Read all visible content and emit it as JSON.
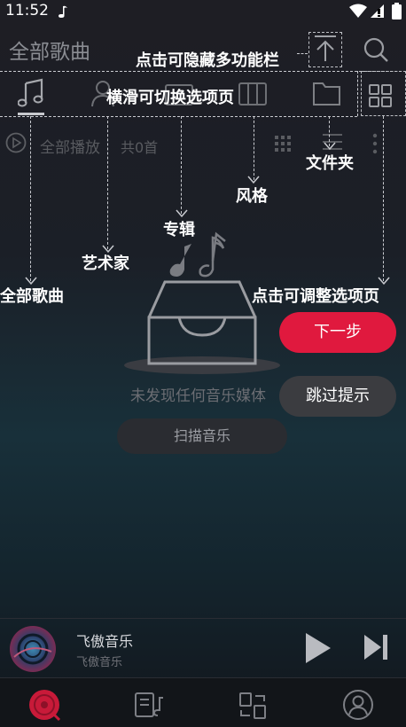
{
  "status": {
    "time": "11:52"
  },
  "header": {
    "title": "全部歌曲"
  },
  "tabs": [
    {
      "name": "songs"
    },
    {
      "name": "artists"
    },
    {
      "name": "albums"
    },
    {
      "name": "genres"
    },
    {
      "name": "folders"
    }
  ],
  "list_header": {
    "play_all": "全部播放",
    "count": "共0首"
  },
  "empty": {
    "message": "未发现任何音乐媒体",
    "scan_button": "扫描音乐"
  },
  "guide": {
    "hide_toolbar": "点击可隐藏多功能栏",
    "swipe_tabs": "横滑可切换选项页",
    "folder": "文件夹",
    "genre": "风格",
    "album": "专辑",
    "artist": "艺术家",
    "all_songs": "全部歌曲",
    "adjust_tabs": "点击可调整选项页",
    "next_button": "下一步",
    "skip_button": "跳过提示"
  },
  "player": {
    "title": "飞傲音乐",
    "subtitle": "飞傲音乐"
  },
  "colors": {
    "accent": "#e0193e",
    "background": "#1a1c22"
  }
}
